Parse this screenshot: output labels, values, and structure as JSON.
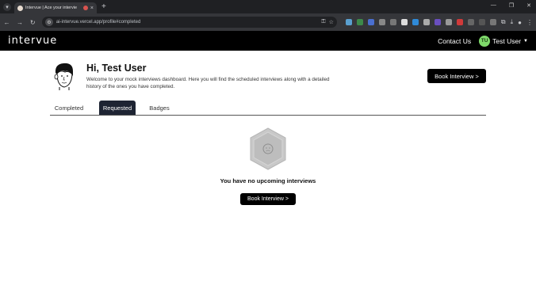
{
  "browser": {
    "tab_title": "Intervue | Ace your intervie",
    "url": "ai-intervue.vercel.app/profile#completed",
    "new_tab": "+",
    "close_tab": "×"
  },
  "header": {
    "logo": "intervue",
    "contact_label": "Contact Us",
    "avatar_initials": "TU",
    "user_name": "Test User"
  },
  "profile": {
    "greeting": "Hi, Test User",
    "description": "Welcome to your mock interviews dashboard. Here you will find the scheduled interviews along with a detailed history of the ones you have completed.",
    "book_button": "Book Interview >"
  },
  "tabs": [
    {
      "label": "Completed",
      "active": false
    },
    {
      "label": "Requested",
      "active": true
    },
    {
      "label": "Badges",
      "active": false
    }
  ],
  "empty_state": {
    "message": "You have no upcoming interviews",
    "book_button": "Book Interview >"
  },
  "colors": {
    "header_bg": "#000000",
    "active_tab_bg": "#1e2433",
    "avatar_bg": "#7ed96a"
  }
}
